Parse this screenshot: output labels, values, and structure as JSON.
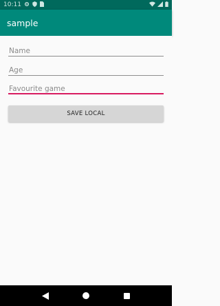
{
  "status_bar": {
    "time": "10:11",
    "icons": [
      "settings-icon",
      "shield-icon",
      "sim-card-icon",
      "wifi-icon",
      "signal-icon",
      "battery-icon"
    ]
  },
  "app_bar": {
    "title": "sample",
    "color": "#00897b",
    "status_color": "#00695c"
  },
  "form": {
    "name": {
      "placeholder": "Name",
      "value": ""
    },
    "age": {
      "placeholder": "Age",
      "value": ""
    },
    "favourite_game": {
      "placeholder": "Favourite game",
      "value": ""
    },
    "focused_accent": "#d81b60",
    "save_label": "SAVE LOCAL"
  },
  "nav_bar": {
    "icons": [
      "back-icon",
      "home-icon",
      "recents-icon"
    ]
  }
}
